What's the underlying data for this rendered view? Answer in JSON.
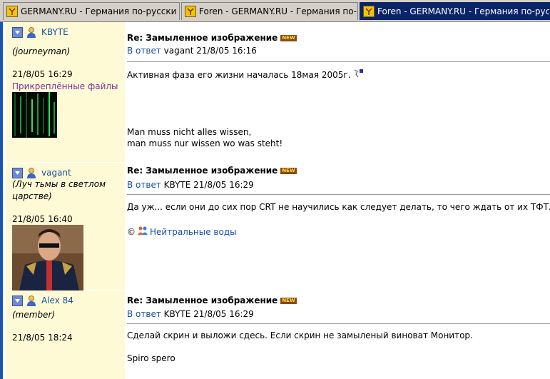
{
  "tabs": [
    {
      "title": "GERMANY.RU - Германия по-русски",
      "active": false
    },
    {
      "title": "Foren - GERMANY.RU - Германия по-русски",
      "active": false
    },
    {
      "title": "Foren - GERMANY.RU - Германия по-русски",
      "active": true
    }
  ],
  "posts": [
    {
      "username": "KBYTE",
      "rank": "(journeyman)",
      "date": "21/8/05 16:29",
      "attachments_label": "Прикреплённые файлы",
      "subject": "Re: Замыленное изображение",
      "new_badge": "NEW",
      "reply_label": "В ответ",
      "reply_info": "vagant 21/8/05 16:16",
      "body_line_1": "Активная фаза его жизни началась 18мая 2005г.",
      "sig_line_1": "Man muss nicht alles wissen,",
      "sig_line_2": "man muss nur wissen wo was steht!"
    },
    {
      "username": "vagant",
      "rank": "(Луч тьмы в светлом царстве)",
      "date": "21/8/05 16:40",
      "subject": "Re: Замыленное изображение",
      "new_badge": "NEW",
      "reply_label": "В ответ",
      "reply_info": "KBYTE 21/8/05 16:29",
      "body_line_1": "Да уж... если они до сих пор CRT не научились как следует делать, то чего ждать от их ТФТ.",
      "sig_prefix": "©",
      "sig_link": "Нейтральные воды"
    },
    {
      "username": "Alex 84",
      "rank": "(member)",
      "date": "21/8/05 18:24",
      "subject": "Re: Замыленное изображение",
      "new_badge": "NEW",
      "reply_label": "В ответ",
      "reply_info": "KBYTE 21/8/05 16:29",
      "body_line_1": "Сделай скрин и выложи сдесь. Если скрин не замыленый виноват Монитор.",
      "sig_line_1": "Spiro spero"
    }
  ]
}
